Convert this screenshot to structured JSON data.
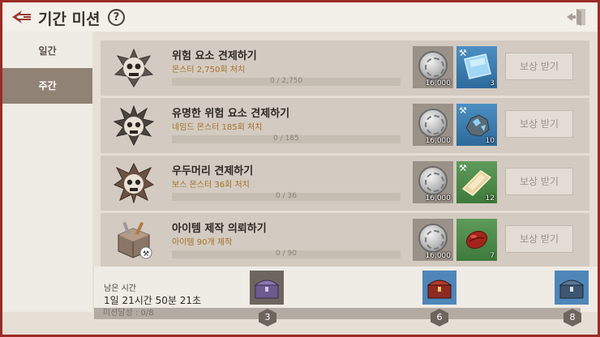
{
  "header": {
    "title": "기간 미션",
    "help_label": "?"
  },
  "sidebar": {
    "tabs": [
      {
        "label": "일간",
        "active": false
      },
      {
        "label": "주간",
        "active": true
      }
    ]
  },
  "missions": [
    {
      "title": "위험 요소 견제하기",
      "subtitle": "몬스터 2,750회 처치",
      "progress_text": "0 / 2,750",
      "progress": 0,
      "emblem": "skull-emblem-icon",
      "rewards": [
        {
          "icon": "silver-coin-icon",
          "qty": "16,000"
        },
        {
          "icon": "blue-crystal-slab-icon",
          "qty": "3",
          "color": "blue"
        }
      ],
      "claim_label": "보상 받기"
    },
    {
      "title": "유명한 위험 요소 견제하기",
      "subtitle": "네임드 몬스터 185회 처치",
      "progress_text": "0 / 185",
      "progress": 0,
      "emblem": "horned-skull-emblem-icon",
      "rewards": [
        {
          "icon": "silver-coin-icon",
          "qty": "16,000"
        },
        {
          "icon": "blue-ore-icon",
          "qty": "10",
          "color": "blue"
        }
      ],
      "claim_label": "보상 받기"
    },
    {
      "title": "우두머리 견제하기",
      "subtitle": "보스 몬스터 36회 처치",
      "progress_text": "0 / 36",
      "progress": 0,
      "emblem": "boss-skull-emblem-icon",
      "rewards": [
        {
          "icon": "silver-coin-icon",
          "qty": "16,000"
        },
        {
          "icon": "gold-slab-icon",
          "qty": "12",
          "color": "green"
        }
      ],
      "claim_label": "보상 받기"
    },
    {
      "title": "아이템 제작 의뢰하기",
      "subtitle": "아이템 90개 제작",
      "progress_text": "0 / 90",
      "progress": 0,
      "emblem": "crafting-crate-icon",
      "rewards": [
        {
          "icon": "silver-coin-icon",
          "qty": "16,000"
        },
        {
          "icon": "red-bean-icon",
          "qty": "7",
          "color": "green"
        }
      ],
      "claim_label": "보상 받기"
    }
  ],
  "footer": {
    "remaining_label": "남은 시간",
    "remaining_time": "1일 21시간 50분 21초",
    "achievement_label": "미션달성 : 0/8",
    "achievement_progress": 0,
    "chests": [
      {
        "icon": "purple-chest-icon",
        "step": "3"
      },
      {
        "icon": "red-chest-icon",
        "step": "6"
      },
      {
        "icon": "blue-chest-icon",
        "step": "8"
      }
    ]
  },
  "colors": {
    "frame": "#9c2b26",
    "active_tab": "#908275",
    "subtitle": "#a5702a"
  }
}
